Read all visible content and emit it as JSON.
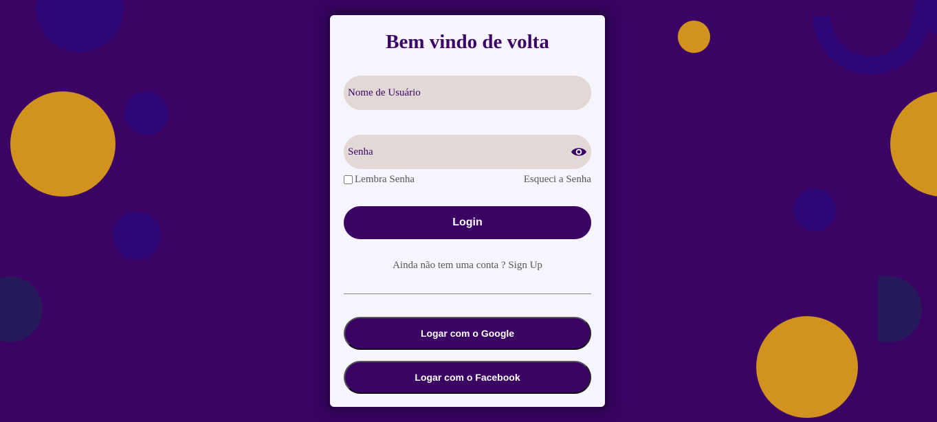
{
  "colors": {
    "background": "#3a0364",
    "card": "#f6f5fe",
    "accent": "#3a0364",
    "field": "#e2d8d6",
    "gold": "#d2921e",
    "navy_circle": "#2e0876"
  },
  "login_card": {
    "title": "Bem vindo de volta",
    "username": {
      "placeholder": "Nome de Usuário",
      "value": ""
    },
    "password": {
      "placeholder": "Senha",
      "value": "",
      "toggle_icon": "eye-icon"
    },
    "remember_label": "Lembra Senha",
    "forgot_label": "Esqueci a Senha",
    "login_label": "Login",
    "signup_prompt": "Ainda não tem uma conta ?",
    "signup_label": "Sign Up",
    "google_label": "Logar com o Google",
    "facebook_label": "Logar com o Facebook"
  }
}
